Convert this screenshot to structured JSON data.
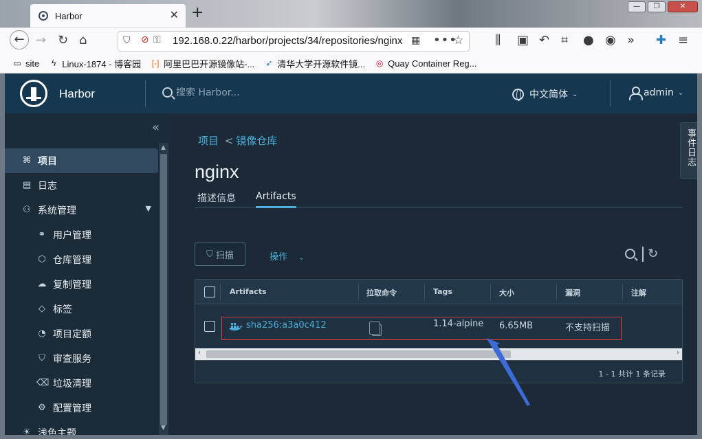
{
  "browser": {
    "tab_title": "Harbor",
    "tab_close": "✕",
    "new_tab": "+",
    "url": "192.168.0.22/harbor/projects/34/repositories/nginx",
    "window_buttons": [
      "—",
      "❐",
      "✕"
    ],
    "bookmarks": [
      {
        "label": "site",
        "icon": "folder-icon"
      },
      {
        "label": "Linux-1874 - 博客园",
        "icon": "cnblogs-icon"
      },
      {
        "label": "阿里巴巴开源镜像站-...",
        "icon": "aliyun-icon"
      },
      {
        "label": "清华大学开源软件镜...",
        "icon": "tuna-icon"
      },
      {
        "label": "Quay Container Reg...",
        "icon": "quay-icon"
      }
    ]
  },
  "header": {
    "brand": "Harbor",
    "search_placeholder": "搜索 Harbor...",
    "language": "中文简体",
    "user": "admin"
  },
  "sidebar": {
    "items": [
      {
        "label": "项目",
        "icon": "projects-icon",
        "active": true
      },
      {
        "label": "日志",
        "icon": "logs-icon"
      },
      {
        "label": "系统管理",
        "icon": "admin-icon",
        "expandable": true
      },
      {
        "label": "用户管理",
        "icon": "users-icon"
      },
      {
        "label": "仓库管理",
        "icon": "registry-icon"
      },
      {
        "label": "复制管理",
        "icon": "replication-icon"
      },
      {
        "label": "标签",
        "icon": "tag-icon"
      },
      {
        "label": "项目定额",
        "icon": "quota-icon"
      },
      {
        "label": "审查服务",
        "icon": "shield-icon"
      },
      {
        "label": "垃圾清理",
        "icon": "trash-icon"
      },
      {
        "label": "配置管理",
        "icon": "gear-icon"
      },
      {
        "label": "浅色主题",
        "icon": "sun-icon"
      }
    ]
  },
  "main": {
    "breadcrumb": [
      "项目",
      "镜像仓库"
    ],
    "breadcrumb_sep": "<",
    "title": "nginx",
    "tabs": [
      {
        "label": "描述信息",
        "active": false
      },
      {
        "label": "Artifacts",
        "active": true
      }
    ],
    "scan_button": "扫描",
    "actions_label": "操作",
    "table": {
      "columns": [
        "Artifacts",
        "拉取命令",
        "Tags",
        "大小",
        "漏洞",
        "注解"
      ],
      "rows": [
        {
          "artifact": "sha256:a3a0c412",
          "tags": "1.14-alpine",
          "size": "6.65MB",
          "vulnerabilities": "不支持扫描"
        }
      ],
      "footer": "1 - 1 共计 1 条记录"
    }
  },
  "event_log_tab": "事件日志",
  "colors": {
    "accent": "#4aaed9",
    "header_bg": "#15374f",
    "sidebar_bg": "#1c2b38",
    "highlight_box": "#e0403a",
    "arrow": "#3d6cd9"
  }
}
